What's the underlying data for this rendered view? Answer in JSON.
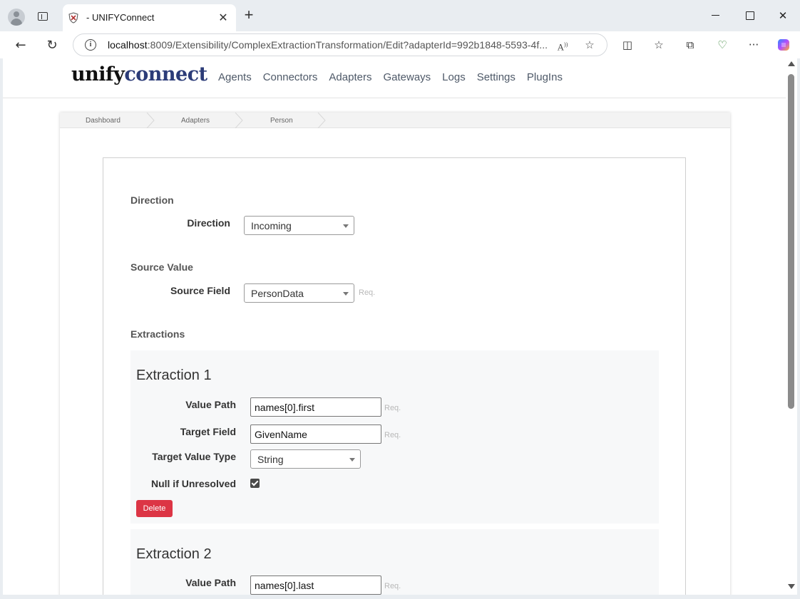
{
  "browser": {
    "tab_title": "- UNIFYConnect",
    "url_host": "localhost",
    "url_rest": ":8009/Extensibility/ComplexExtractionTransformation/Edit?adapterId=992b1848-5593-4f..."
  },
  "site": {
    "logo_part1": "unify",
    "logo_part2": "connect",
    "nav": [
      "Agents",
      "Connectors",
      "Adapters",
      "Gateways",
      "Logs",
      "Settings",
      "PlugIns"
    ]
  },
  "breadcrumb": [
    "Dashboard",
    "Adapters",
    "Person"
  ],
  "form": {
    "direction_section": "Direction",
    "direction_label": "Direction",
    "direction_value": "Incoming",
    "source_section": "Source Value",
    "source_label": "Source Field",
    "source_value": "PersonData",
    "req": "Req.",
    "extractions_section": "Extractions",
    "extractions": [
      {
        "title": "Extraction 1",
        "value_path_label": "Value Path",
        "value_path": "names[0].first",
        "target_field_label": "Target Field",
        "target_field": "GivenName",
        "target_type_label": "Target Value Type",
        "target_type": "String",
        "null_label": "Null if Unresolved",
        "null_checked": true,
        "delete_label": "Delete"
      },
      {
        "title": "Extraction 2",
        "value_path_label": "Value Path",
        "value_path": "names[0].last"
      }
    ]
  },
  "colors": {
    "brand_dark": "#2c3c78",
    "danger": "#dc3545"
  }
}
